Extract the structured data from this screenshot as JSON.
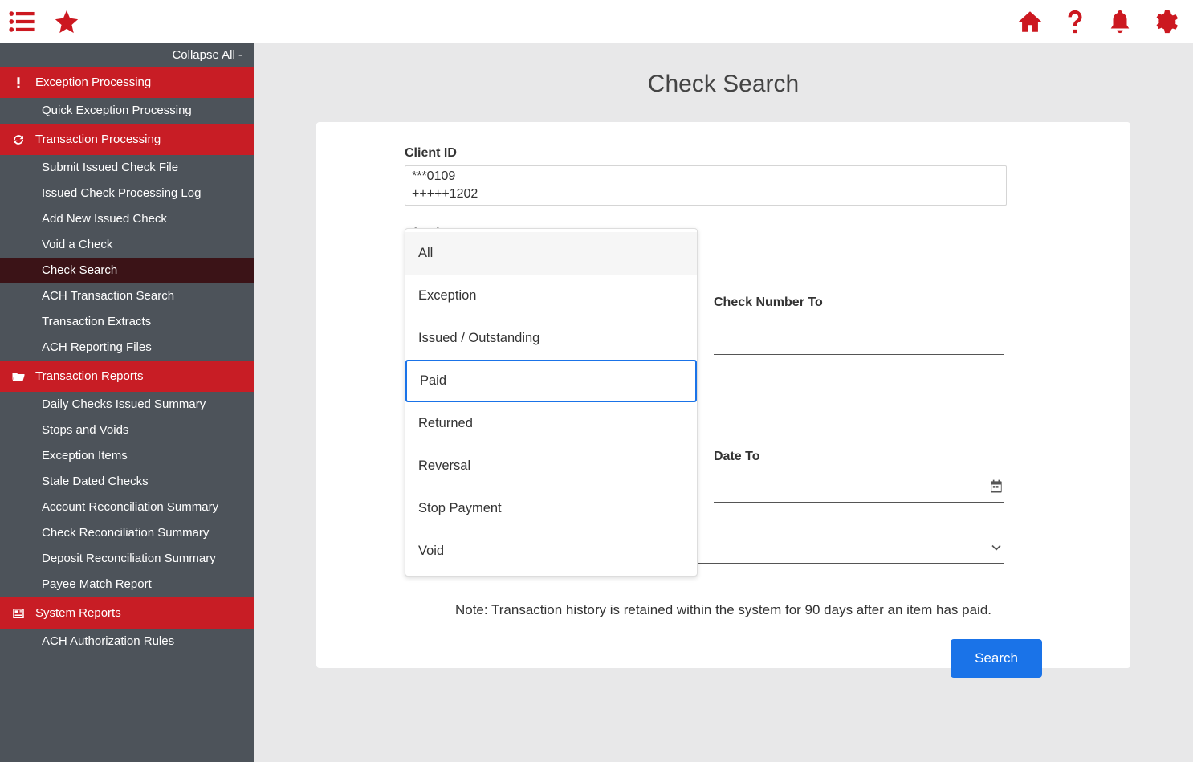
{
  "topbar": {
    "left_icons": [
      "menu-list-icon",
      "star-icon"
    ],
    "right_icons": [
      "home-icon",
      "help-icon",
      "bell-icon",
      "gear-icon"
    ]
  },
  "sidebar": {
    "collapse_label": "Collapse All -",
    "sections": [
      {
        "label": "Exception Processing",
        "icon": "alert-icon",
        "items": [
          "Quick Exception Processing"
        ]
      },
      {
        "label": "Transaction Processing",
        "icon": "refresh-icon",
        "items": [
          "Submit Issued Check File",
          "Issued Check Processing Log",
          "Add New Issued Check",
          "Void a Check",
          "Check Search",
          "ACH Transaction Search",
          "Transaction Extracts",
          "ACH Reporting Files"
        ],
        "active_index": 4
      },
      {
        "label": "Transaction Reports",
        "icon": "folder-open-icon",
        "items": [
          "Daily Checks Issued Summary",
          "Stops and Voids",
          "Exception Items",
          "Stale Dated Checks",
          "Account Reconciliation Summary",
          "Check Reconciliation Summary",
          "Deposit Reconciliation Summary",
          "Payee Match Report"
        ]
      },
      {
        "label": "System Reports",
        "icon": "newspaper-icon",
        "items": [
          "ACH Authorization Rules"
        ]
      }
    ]
  },
  "page": {
    "title": "Check Search",
    "client_id_label": "Client ID",
    "client_id_values": [
      "***0109",
      "+++++1202"
    ],
    "check_status_label": "Check Status",
    "check_number_to_label": "Check Number To",
    "date_to_label": "Date To",
    "note": "Note: Transaction history is retained within the system for 90 days after an item has paid.",
    "search_button": "Search"
  },
  "dropdown": {
    "options": [
      "All",
      "Exception",
      "Issued / Outstanding",
      "Paid",
      "Returned",
      "Reversal",
      "Stop Payment",
      "Void"
    ],
    "hover_index": 0,
    "selected_index": 3
  }
}
